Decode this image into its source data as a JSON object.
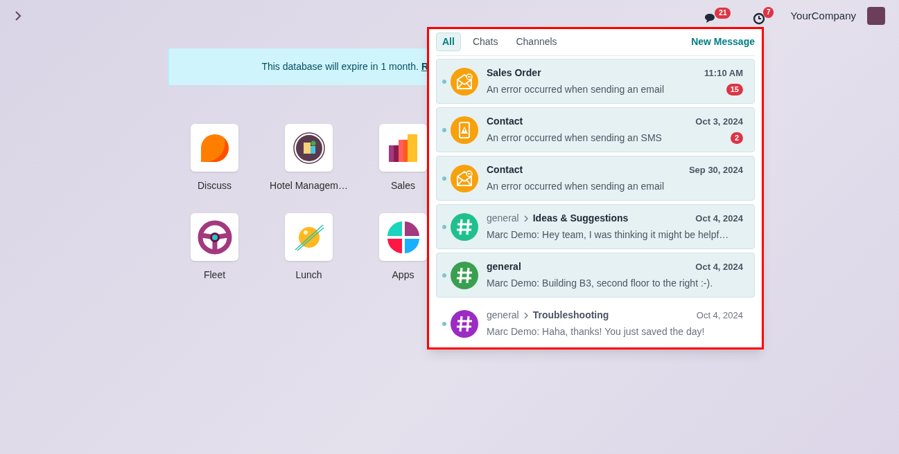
{
  "topbar": {
    "messages_badge": "21",
    "activity_badge": "7",
    "company": "YourCompany"
  },
  "banner": {
    "text": "This database will expire in 1 month.",
    "link": "R"
  },
  "apps": [
    {
      "kind": "discuss",
      "label": "Discuss"
    },
    {
      "kind": "hotel",
      "label": "Hotel Managem…"
    },
    {
      "kind": "sales",
      "label": "Sales"
    },
    {
      "kind": "fleet",
      "label": "Fleet"
    },
    {
      "kind": "lunch",
      "label": "Lunch"
    },
    {
      "kind": "apps",
      "label": "Apps"
    }
  ],
  "messaging": {
    "tabs": [
      {
        "label": "All",
        "selected": true
      },
      {
        "label": "Chats",
        "selected": false
      },
      {
        "label": "Channels",
        "selected": false
      }
    ],
    "new_message": "New Message",
    "threads": [
      {
        "kind": "email",
        "title": "Sales Order",
        "time": "11:10 AM",
        "preview": "An error occurred when sending an email",
        "counter": "15",
        "unread": true
      },
      {
        "kind": "sms",
        "title": "Contact",
        "time": "Oct 3, 2024",
        "preview": "An error occurred when sending an SMS",
        "counter": "2",
        "unread": true
      },
      {
        "kind": "email",
        "title": "Contact",
        "time": "Sep 30, 2024",
        "preview": "An error occurred when sending an email",
        "unread": true
      },
      {
        "kind": "channel",
        "color": "#20c08d",
        "parent": "general",
        "title": "Ideas & Suggestions",
        "time": "Oct 4, 2024",
        "preview": "Marc Demo: Hey team, I was thinking it might be helpf…",
        "unread": true
      },
      {
        "kind": "channel",
        "color": "#3a9f4f",
        "title": "general",
        "time": "Oct 4, 2024",
        "preview": "Marc Demo: Building B3, second floor to the right :-).",
        "unread": true
      },
      {
        "kind": "channel",
        "color": "#9b2bc2",
        "parent": "general",
        "title": "Troubleshooting",
        "time": "Oct 4, 2024",
        "preview": "Marc Demo: Haha, thanks! You just saved the day!",
        "unread": false
      }
    ]
  }
}
